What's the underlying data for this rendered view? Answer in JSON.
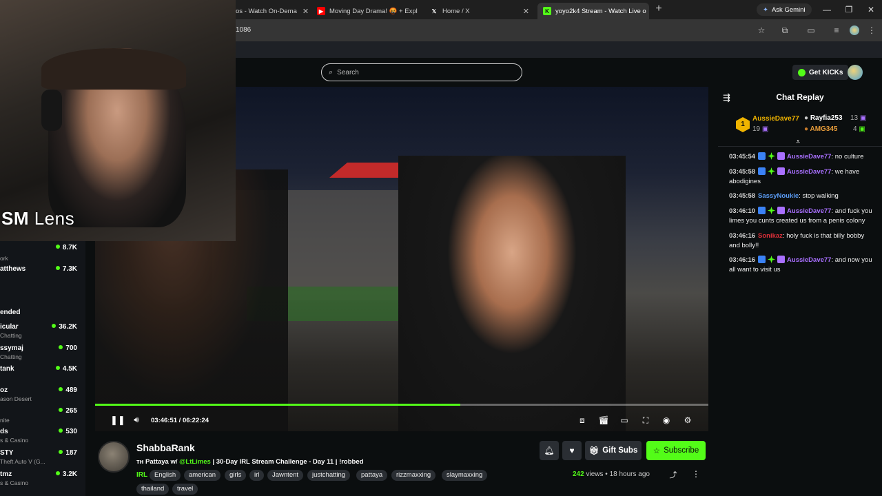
{
  "browser": {
    "tabs": [
      {
        "label": "os - Watch On-Dema",
        "favicon": "kick",
        "color": "#53fc18"
      },
      {
        "label": "Moving Day Drama! 🤬 + Expl",
        "favicon": "youtube",
        "color": "#ff0000"
      },
      {
        "label": "Home / X",
        "favicon": "x",
        "color": "#ffffff"
      },
      {
        "label": "yoyo2k4 Stream - Watch Live o",
        "favicon": "kick",
        "color": "#53fc18"
      }
    ],
    "gemini_label": "Ask Gemini",
    "url": "1086"
  },
  "header": {
    "search_placeholder": "Search",
    "get_kicks_label": "Get KICKs"
  },
  "webcam": {
    "label_bold": "SM",
    "label_rest": " Lens"
  },
  "sidebar": {
    "rows": [
      {
        "name": "",
        "sub": "ork",
        "count": "8.7K"
      },
      {
        "name": "atthews",
        "sub": "",
        "count": "7.3K"
      },
      {
        "name": "icular",
        "sub": "Chatting",
        "count": "36.2K"
      },
      {
        "name": "ssymaj",
        "sub": "Chatting",
        "count": "700"
      },
      {
        "name": "tank",
        "sub": "",
        "count": "4.5K"
      },
      {
        "name": "oz",
        "sub": "ason Desert",
        "count": "489"
      },
      {
        "name": "",
        "sub": "nite",
        "count": "265"
      },
      {
        "name": "ds",
        "sub": "s & Casino",
        "count": "530"
      },
      {
        "name": "STY",
        "sub": "Theft Auto V (G...",
        "count": "187"
      },
      {
        "name": "tmz",
        "sub": "s & Casino",
        "count": "3.2K"
      }
    ],
    "section_heading": "ended"
  },
  "video": {
    "current_time": "03:46:51",
    "separator": " / ",
    "duration": "06:22:24",
    "progress": 0.595
  },
  "chat": {
    "title": "Chat Replay",
    "gifters": [
      {
        "rank": "1",
        "name": "AussieDave77",
        "count": "19"
      },
      {
        "name": "Rayfia253",
        "count": "13"
      },
      {
        "name": "AMG345",
        "count": "4"
      }
    ],
    "messages": [
      {
        "time": "03:45:54",
        "user": "AussieDave77",
        "color": "#a970ff",
        "text": ": no culture",
        "badges": true
      },
      {
        "time": "03:45:58",
        "user": "AussieDave77",
        "color": "#a970ff",
        "text": ": we have abodigines",
        "badges": true
      },
      {
        "time": "03:45:58",
        "user": "SassyNoukie",
        "color": "#5b9cf5",
        "text": ": stop walking",
        "badges": false
      },
      {
        "time": "03:46:10",
        "user": "AussieDave77",
        "color": "#a970ff",
        "text": ": and fuck you limes you cunts created us from a penis colony",
        "badges": true
      },
      {
        "time": "03:46:16",
        "user": "Sonikaz",
        "color": "#e0303a",
        "text": ": holy fuck is that billy bobby and bolly!!",
        "badges": false
      },
      {
        "time": "03:46:16",
        "user": "AussieDave77",
        "color": "#a970ff",
        "text": ": and now you all want to visit us",
        "badges": true
      }
    ]
  },
  "stream": {
    "channel": "ShabbaRank",
    "title_prefix": "ᴛʜ Pattaya w/ ",
    "title_mention": "@LtLimes",
    "title_suffix": " | 30-Day IRL Stream Challenge - Day 11 | !robbed",
    "category": "IRL",
    "tags": [
      "English",
      "american",
      "girls",
      "irl",
      "Jawntent",
      "justchatting",
      "pattaya",
      "rizzmaxxing",
      "slaymaxxing",
      "thailand",
      "travel"
    ],
    "gift_subs_label": "Gift Subs",
    "subscribe_label": "Subscribe",
    "views_count": "242",
    "views_word": "views",
    "age": "18 hours ago",
    "bullet": "•"
  }
}
